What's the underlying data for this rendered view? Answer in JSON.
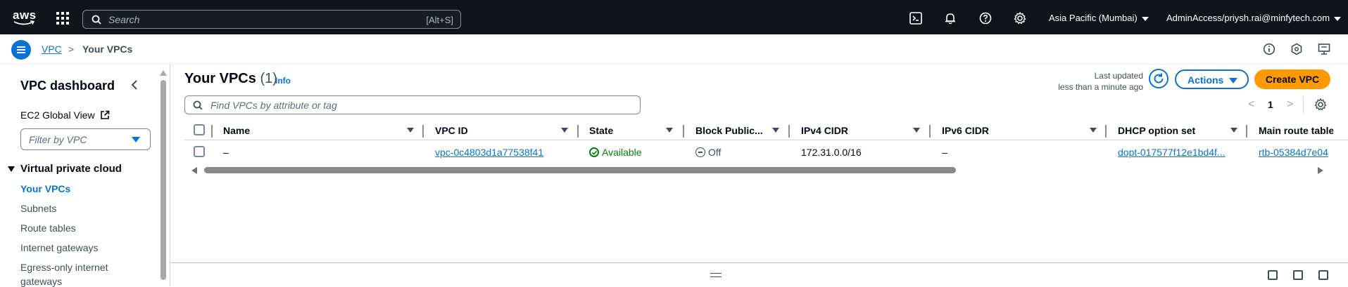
{
  "topnav": {
    "logo_text": "aws",
    "search_placeholder": "Search",
    "search_shortcut": "[Alt+S]",
    "region": "Asia Pacific (Mumbai)",
    "account": "AdminAccess/priysh.rai@minfytech.com"
  },
  "breadcrumb": {
    "root": "VPC",
    "separator": ">",
    "current": "Your VPCs"
  },
  "sidebar": {
    "title": "VPC dashboard",
    "ec2_global_view": "EC2 Global View",
    "filter_placeholder": "Filter by VPC",
    "section": "Virtual private cloud",
    "items": [
      {
        "label": "Your VPCs",
        "active": true
      },
      {
        "label": "Subnets",
        "active": false
      },
      {
        "label": "Route tables",
        "active": false
      },
      {
        "label": "Internet gateways",
        "active": false
      },
      {
        "label": "Egress-only internet",
        "active": false
      },
      {
        "label": "gateways",
        "active": false
      }
    ]
  },
  "main": {
    "title": "Your VPCs",
    "count": "(1)",
    "info": "Info",
    "last_updated_label": "Last updated",
    "last_updated_value": "less than a minute ago",
    "actions_label": "Actions",
    "create_label": "Create VPC",
    "search_placeholder": "Find VPCs by attribute or tag",
    "page_prev": "<",
    "page_number": "1",
    "page_next": ">"
  },
  "table": {
    "columns": [
      "Name",
      "VPC ID",
      "State",
      "Block Public...",
      "IPv4 CIDR",
      "IPv6 CIDR",
      "DHCP option set",
      "Main route table"
    ],
    "rows": [
      {
        "name": "–",
        "vpc_id": "vpc-0c4803d1a77538f41",
        "state": "Available",
        "block_public": "Off",
        "ipv4_cidr": "172.31.0.0/16",
        "ipv6_cidr": "–",
        "dhcp_option_set": "dopt-017577f12e1bd4f...",
        "main_route_table": "rtb-05384d7e04"
      }
    ]
  },
  "colors": {
    "nav_bg": "#0f141a",
    "link": "#0972d3",
    "primary_button": "#ff9900",
    "success": "#037f0c"
  }
}
